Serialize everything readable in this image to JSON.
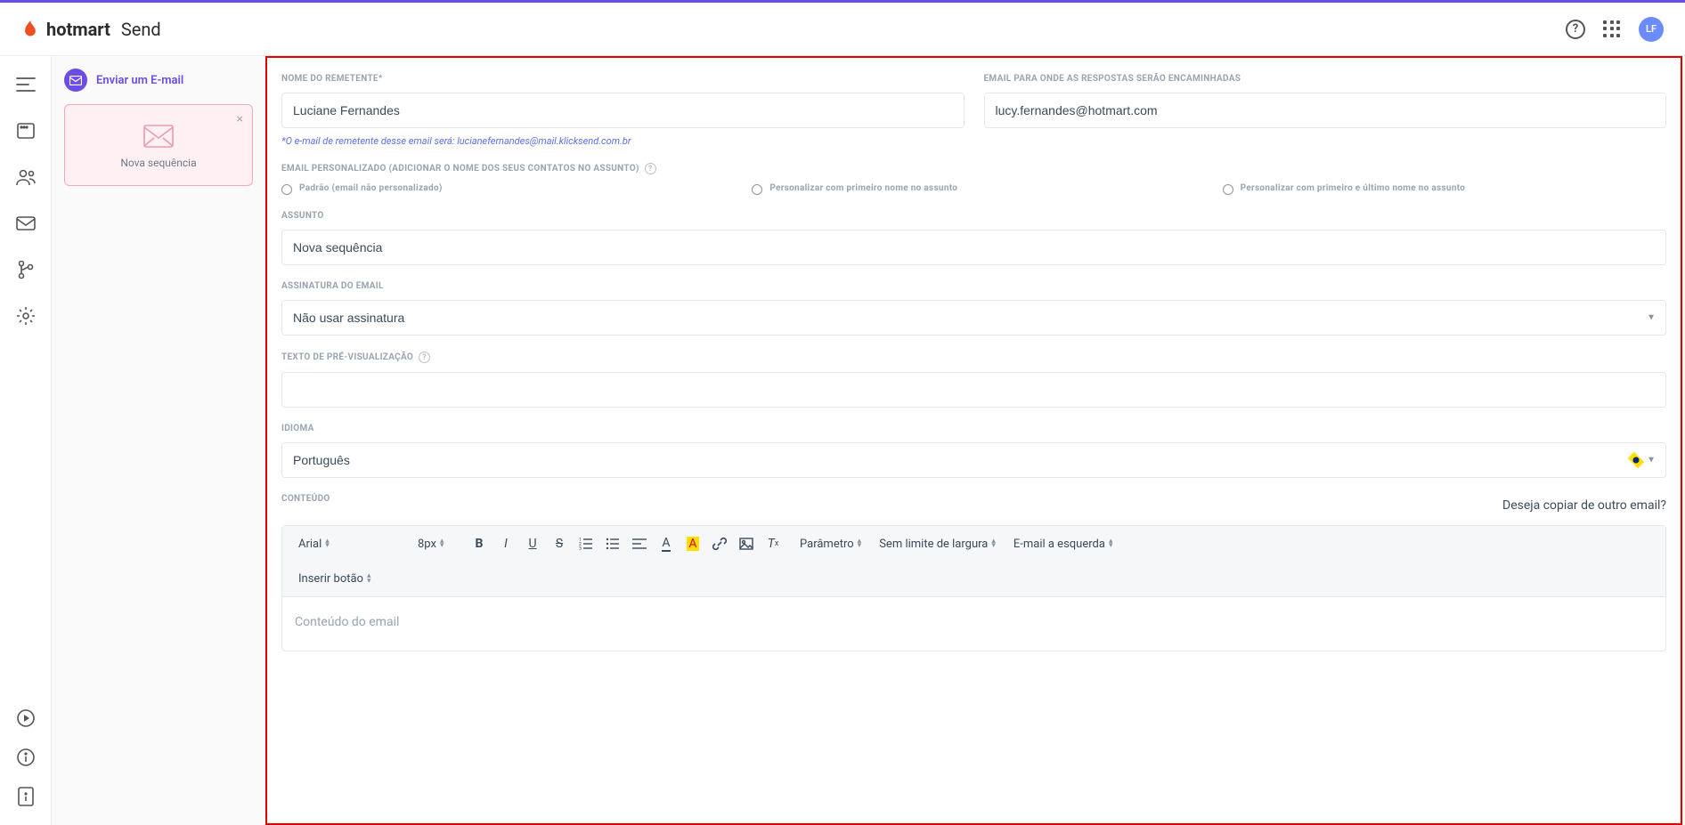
{
  "header": {
    "brand": "hotmart",
    "product": "Send",
    "avatar_initials": "LF"
  },
  "sequence": {
    "header_label": "Enviar um E-mail",
    "card_label": "Nova sequência"
  },
  "form": {
    "sender_name_label": "Nome do Remetente*",
    "sender_name_value": "Luciane Fernandes",
    "reply_email_label": "Email para onde as respostas serão encaminhadas",
    "reply_email_value": "lucy.fernandes@hotmart.com",
    "sender_hint": "*O e-mail de remetente desse email será: lucianefernandes@mail.klicksend.com.br",
    "personalized_label": "Email personalizado (adicionar o nome dos seus contatos no assunto)",
    "radio_default": "Padrão (email não personalizado)",
    "radio_first": "Personalizar com primeiro nome no assunto",
    "radio_full": "Personalizar com primeiro e último nome no assunto",
    "subject_label": "Assunto",
    "subject_value": "Nova sequência",
    "signature_label": "Assinatura do email",
    "signature_value": "Não usar assinatura",
    "preview_label": "Texto de pré-visualização",
    "preview_value": "",
    "language_label": "Idioma",
    "language_value": "Português",
    "content_label": "Conteúdo",
    "copy_link": "Deseja copiar de outro email?",
    "editor_placeholder": "Conteúdo do email"
  },
  "toolbar": {
    "font": "Arial",
    "size": "8px",
    "param": "Parâmetro",
    "width": "Sem limite de largura",
    "align": "E-mail a esquerda",
    "insert_button": "Inserir botão"
  }
}
